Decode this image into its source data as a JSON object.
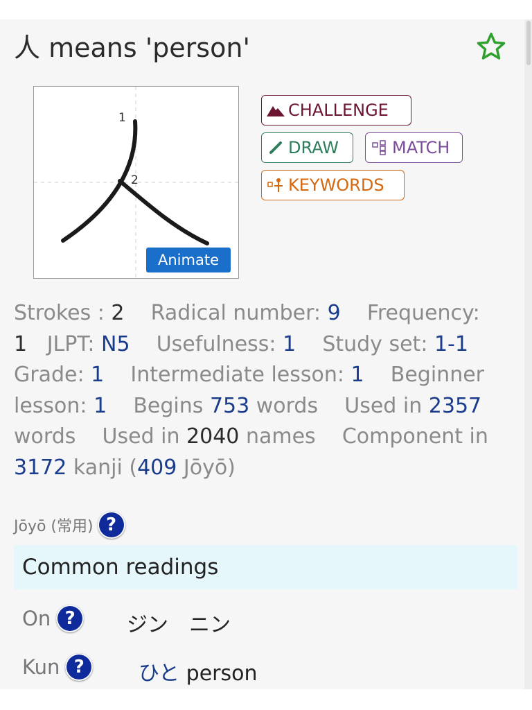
{
  "header": {
    "kanji": "人",
    "title_rest": " means 'person'",
    "favorite_icon": "star-outline-icon"
  },
  "stroke_diagram": {
    "stroke_numbers": [
      "1",
      "2"
    ],
    "animate_label": "Animate"
  },
  "actions": {
    "challenge": "CHALLENGE",
    "draw": "DRAW",
    "match": "MATCH",
    "keywords": "KEYWORDS"
  },
  "stats": {
    "strokes_label": "Strokes : ",
    "strokes": "2",
    "radical_label": "Radical number: ",
    "radical": "9",
    "frequency_label": "Frequency:",
    "frequency": "1",
    "jlpt_label": "JLPT: ",
    "jlpt": "N5",
    "usefulness_label": "Usefulness: ",
    "usefulness": "1",
    "study_set_label": "Study set: ",
    "study_set": "1-1",
    "grade_label": "Grade: ",
    "grade": "1",
    "intermediate_label": "Intermediate lesson: ",
    "intermediate": "1",
    "beginner_label_1": "Beginner",
    "beginner_label_2": "lesson: ",
    "beginner": "1",
    "begins_label": "Begins ",
    "begins": "753",
    "begins_suffix": " words",
    "used_in_label": "Used in ",
    "used_in": "2357",
    "used_in_suffix_words": "words",
    "names_label": "Used in ",
    "names": "2040",
    "names_suffix": " names",
    "component_label": "Component in",
    "component": "3172",
    "component_kanji": " kanji (",
    "component_joyo": "409",
    "component_joyo_suffix": " Jōyō)"
  },
  "joyo": {
    "label": "Jōyō (常用)"
  },
  "readings": {
    "heading": "Common readings",
    "on_label": "On",
    "on_value": "ジン　ニン",
    "kun_label": "Kun",
    "kun_kana": "ひと",
    "kun_meaning": " person"
  },
  "colors": {
    "challenge": "#6b1530",
    "draw": "#2e7d5b",
    "match": "#7b4e9a",
    "keywords": "#d4670f",
    "link": "#1a3c8c",
    "animate": "#1a6fcb",
    "star": "#2ea02e"
  }
}
